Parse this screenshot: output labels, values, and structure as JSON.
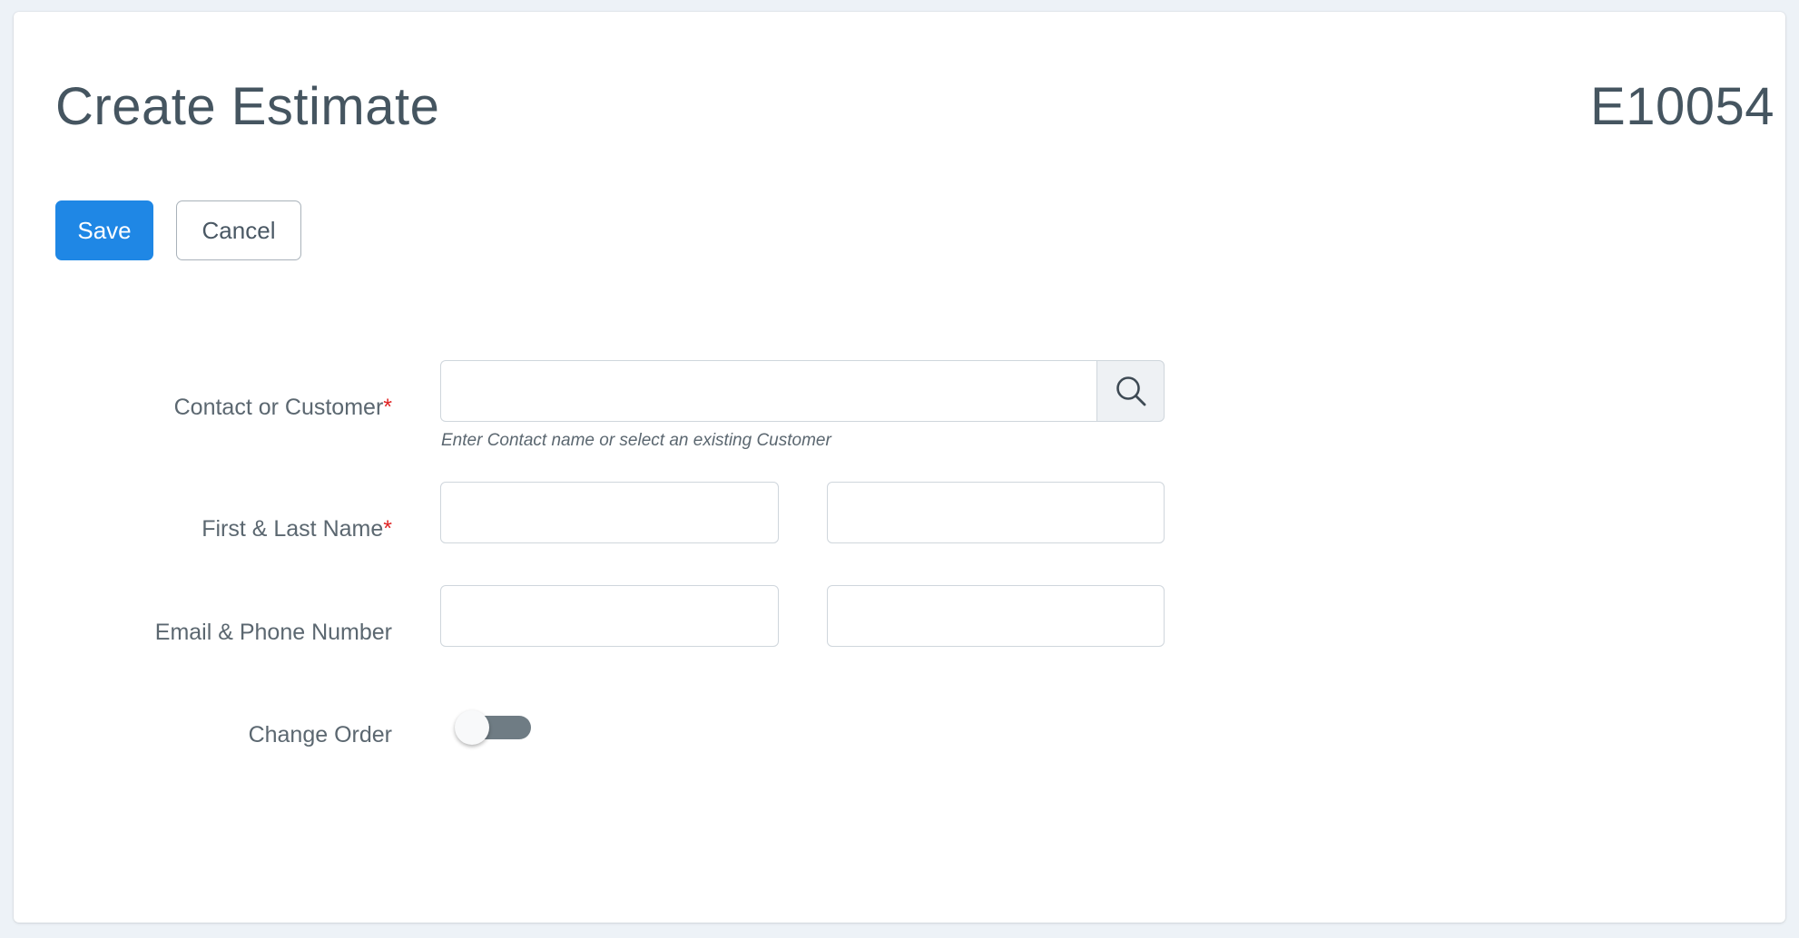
{
  "header": {
    "title": "Create Estimate",
    "estimate_number": "E10054"
  },
  "actions": {
    "save_label": "Save",
    "cancel_label": "Cancel"
  },
  "form": {
    "contact": {
      "label": "Contact or Customer",
      "required_mark": "*",
      "value": "",
      "help": "Enter Contact name or select an existing Customer",
      "search_icon": "search-icon"
    },
    "name": {
      "label": "First & Last Name",
      "required_mark": "*",
      "first_value": "",
      "last_value": ""
    },
    "contact_info": {
      "label": "Email & Phone Number",
      "email_value": "",
      "phone_value": ""
    },
    "change_order": {
      "label": "Change Order",
      "enabled": false
    }
  },
  "colors": {
    "primary": "#1f87e5",
    "required": "#e02424",
    "page_background": "#edf2f7",
    "toggle_track": "#6f7c84"
  }
}
